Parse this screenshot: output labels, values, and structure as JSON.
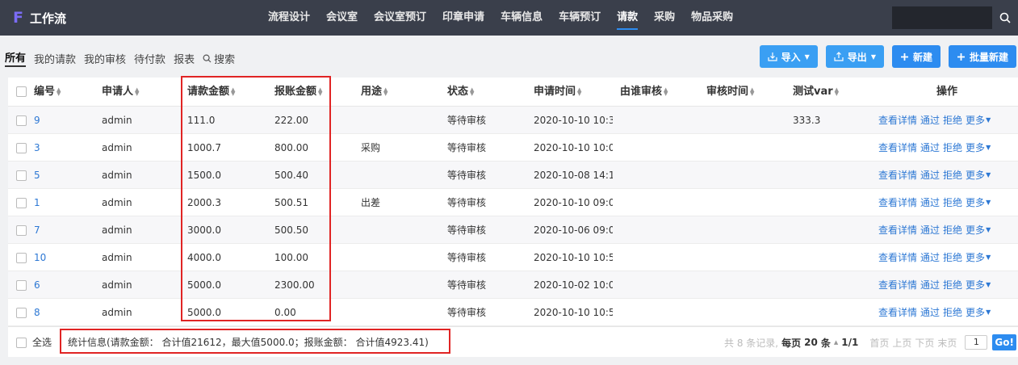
{
  "brand": {
    "logo": "F",
    "name": "工作流"
  },
  "nav": {
    "items": [
      "流程设计",
      "会议室",
      "会议室预订",
      "印章申请",
      "车辆信息",
      "车辆预订",
      "请款",
      "采购",
      "物品采购"
    ],
    "active_index": 6,
    "search_placeholder": ""
  },
  "tabs": {
    "items": [
      "所有",
      "我的请款",
      "我的审核",
      "待付款",
      "报表"
    ],
    "search_label": "搜索"
  },
  "actions": {
    "import": "导入",
    "export": "导出",
    "create": "新建",
    "batch_create": "批量新建"
  },
  "table": {
    "columns": [
      "编号",
      "申请人",
      "请款金额",
      "报账金额",
      "用途",
      "状态",
      "申请时间",
      "由谁审核",
      "审核时间",
      "测试var",
      "操作"
    ],
    "rows": [
      {
        "id": "9",
        "applicant": "admin",
        "amount": "111.0",
        "reimburse": "222.00",
        "purpose": "",
        "status": "等待审核",
        "time": "2020-10-10 10:3(",
        "reviewer": "",
        "review_time": "",
        "var": "333.3"
      },
      {
        "id": "3",
        "applicant": "admin",
        "amount": "1000.7",
        "reimburse": "800.00",
        "purpose": "采购",
        "status": "等待审核",
        "time": "2020-10-10 10:0",
        "reviewer": "",
        "review_time": "",
        "var": ""
      },
      {
        "id": "5",
        "applicant": "admin",
        "amount": "1500.0",
        "reimburse": "500.40",
        "purpose": "",
        "status": "等待审核",
        "time": "2020-10-08 14:1(",
        "reviewer": "",
        "review_time": "",
        "var": ""
      },
      {
        "id": "1",
        "applicant": "admin",
        "amount": "2000.3",
        "reimburse": "500.51",
        "purpose": "出差",
        "status": "等待审核",
        "time": "2020-10-10 09:0",
        "reviewer": "",
        "review_time": "",
        "var": ""
      },
      {
        "id": "7",
        "applicant": "admin",
        "amount": "3000.0",
        "reimburse": "500.50",
        "purpose": "",
        "status": "等待审核",
        "time": "2020-10-06 09:0",
        "reviewer": "",
        "review_time": "",
        "var": ""
      },
      {
        "id": "10",
        "applicant": "admin",
        "amount": "4000.0",
        "reimburse": "100.00",
        "purpose": "",
        "status": "等待审核",
        "time": "2020-10-10 10:5",
        "reviewer": "",
        "review_time": "",
        "var": ""
      },
      {
        "id": "6",
        "applicant": "admin",
        "amount": "5000.0",
        "reimburse": "2300.00",
        "purpose": "",
        "status": "等待审核",
        "time": "2020-10-02 10:0(",
        "reviewer": "",
        "review_time": "",
        "var": ""
      },
      {
        "id": "8",
        "applicant": "admin",
        "amount": "5000.0",
        "reimburse": "0.00",
        "purpose": "",
        "status": "等待审核",
        "time": "2020-10-10 10:5(",
        "reviewer": "",
        "review_time": "",
        "var": ""
      }
    ],
    "row_actions": [
      "查看详情",
      "通过",
      "拒绝",
      "更多"
    ]
  },
  "footer": {
    "select_all": "全选",
    "stats": "统计信息(请款金额： 合计值21612，最大值5000.0；报账金额： 合计值4923.41)",
    "total": "共 8 条记录,",
    "per_page_label": "每页",
    "per_page": "20",
    "per_page_unit": "条",
    "page_info": "1/1",
    "first": "首页",
    "prev": "上页",
    "next": "下页",
    "last": "末页",
    "page_input": "1",
    "go": "Go!"
  },
  "colors": {
    "navbar": "#3a3f4b",
    "accent": "#2d8cf0",
    "link": "#2d78d4",
    "highlight": "#e02424"
  }
}
